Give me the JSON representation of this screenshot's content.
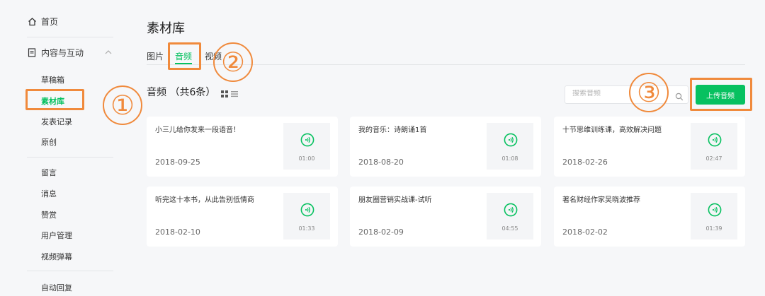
{
  "sidebar": {
    "home_label": "首页",
    "group_label": "内容与互动",
    "group_items": [
      "草稿箱",
      "素材库",
      "发表记录",
      "原创"
    ],
    "other_items": [
      "留言",
      "消息",
      "赞赏",
      "用户管理",
      "视频弹幕"
    ],
    "bottom_items": [
      "自动回复"
    ]
  },
  "page": {
    "title": "素材库",
    "tabs": [
      "图片",
      "音频",
      "视频"
    ],
    "active_tab": "音频",
    "section_title": "音频 （共6条）"
  },
  "search": {
    "placeholder": "搜索音频"
  },
  "upload_button": "上传音频",
  "cards": [
    {
      "title": "小三儿给你发来一段语音！",
      "date": "2018-09-25",
      "duration": "01:00"
    },
    {
      "title": "我的音乐：诗朗诵1首",
      "date": "2018-08-20",
      "duration": "01:08"
    },
    {
      "title": "十节思维训练课，高效解决问题",
      "date": "2018-02-26",
      "duration": "02:47"
    },
    {
      "title": "听完这十本书，从此告别低情商",
      "date": "2018-02-10",
      "duration": "01:33"
    },
    {
      "title": "朋友圈营销实战课-试听",
      "date": "2018-02-09",
      "duration": "04:55"
    },
    {
      "title": "著名财经作家吴晓波推荐",
      "date": "2018-02-02",
      "duration": "01:39"
    }
  ],
  "annotations": [
    "①",
    "②",
    "③"
  ],
  "colors": {
    "accent": "#07c160",
    "annotation": "#f08a3c"
  },
  "icons": [
    "home-icon",
    "document-icon",
    "chevron-up-icon",
    "grid-view-icon",
    "list-view-icon",
    "search-icon",
    "audio-play-icon"
  ]
}
